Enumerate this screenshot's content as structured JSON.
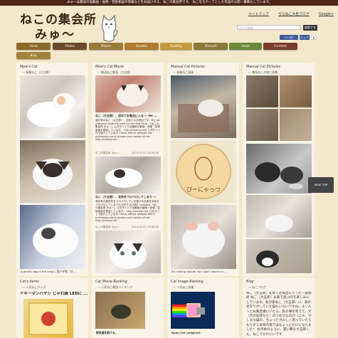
{
  "topbar": {
    "text": "みゅ〜は最幼の猫動画・画像・芸術家画の情報などをお届けする、ねこの集会所です。 ねこをモチーフとした作品の公開・募集もしています。"
  },
  "site": {
    "title_line1": "ねこの集会所",
    "title_line2": "みゅ〜"
  },
  "header_links": [
    "サイトマップ",
    "ぢなねこ大臣ブログ",
    "Google+"
  ],
  "search": {
    "placeholder": "ブログ検索",
    "button": "検索する"
  },
  "social": {
    "likes": "いいね! 1,230",
    "share": "シェア",
    "count": "0"
  },
  "nav": {
    "row1": [
      "home",
      "Photos",
      "Movies",
      "Doodles",
      "Ranking",
      "Manualt",
      "Goods",
      "Contents"
    ],
    "row2": [
      "Blog"
    ]
  },
  "columns": [
    {
      "title": "Mew's Cat",
      "subtitle": "— 画像ねこ（大五郎）",
      "caption": "A plastic bag is the king! | 我ジダ袋、好 ..."
    },
    {
      "title": "Mew's Cat Movie",
      "subtitle": "— 動画ねこ動画（大五郎）",
      "posts": [
        {
          "title": "ねこ（大五郎）、初めてお風呂に入る ― He ...",
          "body": "我が家のねこ（大五郎）、初めてのお風呂です。My cat (Daigoro) took the bath for the first time. 「ねこの集会所 みゅ〜」公式サイトでは最新の動画・画像・芸術家画を発信しています。 http://mew.jp.net/ 公式サイト内で紹介しています Check official website are publishing many photos and movies of cat. http://mew.jp.net",
          "author": "ねこの集会所 みゅ〜",
          "date": "2014-02-01 20:00:00"
        },
        {
          "title": "ねこ（大五郎）、毛布をペロペロしてしまう ―",
          "body": "我が家の猫毛布をペロペロしている猫が大五郎を毛布をペロペロしてしまうから好き(大五郎）dunping 「ねこの集会所 みゅ〜」公式サイトでは最新の動画・画像・芸術家画を発信しています。 http://mew.jp.net 公式サイトで紹介しています Check official website We're publishing many photos and movies of cat. http://mew.jp.net",
          "author": "ねこの集会所 みゅ〜",
          "date": "2014-02-01 20:00:05"
        }
      ]
    },
    {
      "title": "Manual Cat Pictures",
      "subtitle": "— 画像ねこ画像",
      "caption": "It's raining doodle. No I don't wanna w ..."
    },
    {
      "title": "Manual Cat Pictures",
      "subtitle": "— 動画ねこの猫に画像"
    }
  ],
  "bottom": [
    {
      "title": "Cat's Items",
      "subtitle": "— 人気ねこグッズ",
      "headline": "ドギーマンハヤシ じゃれ猫 LEDに ..."
    },
    {
      "title": "Cat Movie Ranking",
      "subtitle": "— 人気ねこ動画ランキング",
      "caption": "野良猫を助ける。"
    },
    {
      "title": "Cat Image Ranking",
      "subtitle": "— 人気ねこ画像",
      "caption": "Nyan Cat (original)"
    },
    {
      "title": "Blog",
      "subtitle": "— ねこブログ",
      "body": "ねこ（大五郎、初めてお風呂に入った一部始終 ねこ（大五郎）お家で遊ぶのを楽しみにしています。私が家ねこ（大五郎）に、家の見守りがしていた猫もいないですね。ルンルンとお風呂場にいたら、私の事を考えて、犬（犬の気持ちと）のつもりなのか（にゃ、かしまな猫の、ちょっとさみしく思っていたらもうぞう日目の夜ではちょっとだけになりました！ お手本のように、狙い撃ち大五郎くん、ねこでかわいいです"
    }
  ],
  "pagetop": "PAGE TOP",
  "colors": {
    "topbar": "#4a2616",
    "background": "#f3e8cc",
    "panel": "#f7f3e6"
  }
}
